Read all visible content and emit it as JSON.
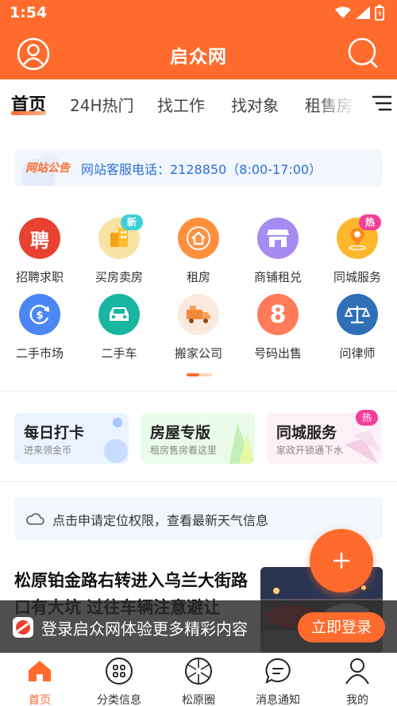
{
  "status": {
    "time": "1:54"
  },
  "header": {
    "title": "启众网"
  },
  "tabs": [
    {
      "label": "首页"
    },
    {
      "label": "24H热门"
    },
    {
      "label": "找工作"
    },
    {
      "label": "找对象"
    },
    {
      "label": "租售房"
    }
  ],
  "notice": {
    "logo": "网站公告",
    "text": "网站客服电话：2128850（8:00-17:00）"
  },
  "grid": [
    {
      "label": "招聘求职",
      "glyph": "聘",
      "color": "#e8412f",
      "icon": "hire-icon"
    },
    {
      "label": "买房卖房",
      "glyph": "",
      "color": "#f8e3a5",
      "icon": "building-icon",
      "badge": "新",
      "badge_color": "#3dd0d8"
    },
    {
      "label": "租房",
      "glyph": "",
      "color": "#ff8f3d",
      "icon": "house-icon"
    },
    {
      "label": "商铺租兑",
      "glyph": "",
      "color": "#a68cf2",
      "icon": "shop-icon"
    },
    {
      "label": "同城服务",
      "glyph": "",
      "color": "#ffb72c",
      "icon": "location-icon",
      "badge": "热",
      "badge_color": "#f2409a"
    },
    {
      "label": "二手市场",
      "glyph": "",
      "color": "#4c86f5",
      "icon": "recycle-money-icon"
    },
    {
      "label": "二手车",
      "glyph": "",
      "color": "#18b6a0",
      "icon": "car-icon"
    },
    {
      "label": "搬家公司",
      "glyph": "",
      "color": "#fbe9de",
      "icon": "truck-icon"
    },
    {
      "label": "号码出售",
      "glyph": "8",
      "color": "#ff7b5a",
      "icon": "number-icon"
    },
    {
      "label": "问律师",
      "glyph": "",
      "color": "#2f6fb5",
      "icon": "scales-icon"
    }
  ],
  "cards": [
    {
      "title": "每日打卡",
      "sub": "进来领金币",
      "bg": "#eaf3ff"
    },
    {
      "title": "房屋专版",
      "sub": "租房售房看这里",
      "bg": "#eafbea"
    },
    {
      "title": "同城服务",
      "sub": "家政开锁通下水",
      "bg": "#fdf0f6",
      "badge": "热"
    }
  ],
  "weather": {
    "text": "点击申请定位权限，查看最新天气信息"
  },
  "news": {
    "title": "松原铂金路右转进入乌兰大街路口有大坑 过往车辆注意避让"
  },
  "login": {
    "text": "登录启众网体验更多精彩内容",
    "button": "立即登录"
  },
  "bottom_nav": [
    {
      "label": "首页",
      "icon": "home-icon"
    },
    {
      "label": "分类信息",
      "icon": "category-icon"
    },
    {
      "label": "松原圈",
      "icon": "circle-icon"
    },
    {
      "label": "消息通知",
      "icon": "message-icon"
    },
    {
      "label": "我的",
      "icon": "user-icon"
    }
  ],
  "colors": {
    "brand": "#ff6b2c",
    "notice_text": "#2b6fd8"
  }
}
